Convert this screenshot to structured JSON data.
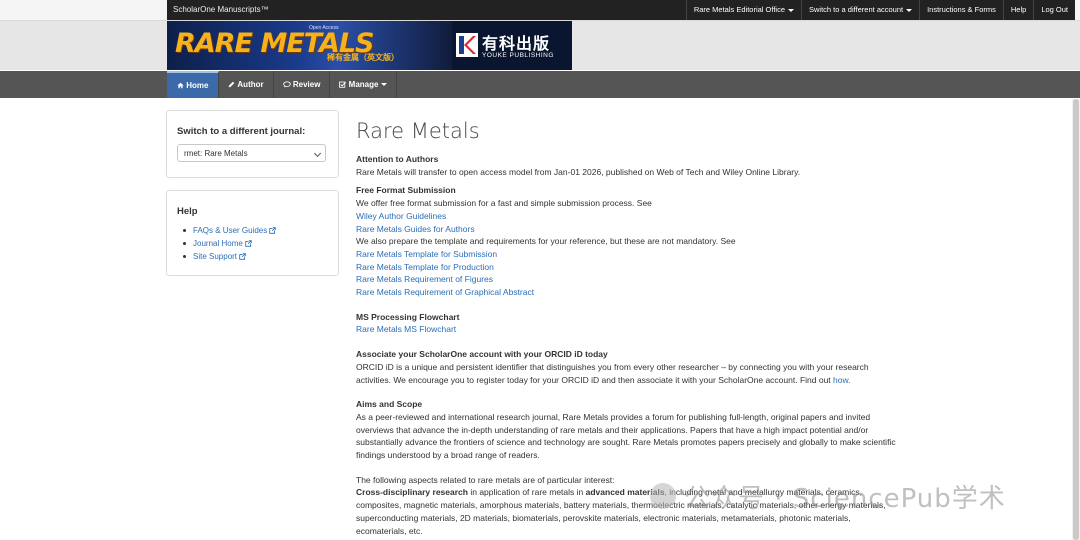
{
  "topbar": {
    "brand": "ScholarOne Manuscripts™",
    "items": [
      {
        "label": "Rare Metals Editorial Office",
        "dropdown": true
      },
      {
        "label": "Switch to a different account",
        "dropdown": true
      },
      {
        "label": "Instructions & Forms",
        "dropdown": false
      },
      {
        "label": "Help",
        "dropdown": false
      },
      {
        "label": "Log Out",
        "dropdown": false
      }
    ]
  },
  "banner": {
    "logo_text": "RARE METALS",
    "open_access": "Open Access",
    "chinese_title": "稀有金属（英文版）",
    "publisher_cn": "有科出版",
    "publisher_en": "YOUKE PUBLISHING"
  },
  "mainnav": {
    "items": [
      {
        "label": "Home",
        "icon": "home-icon",
        "active": true
      },
      {
        "label": "Author",
        "icon": "pencil-icon",
        "active": false
      },
      {
        "label": "Review",
        "icon": "comment-icon",
        "active": false
      },
      {
        "label": "Manage",
        "icon": "checkbox-icon",
        "active": false,
        "dropdown": true
      }
    ]
  },
  "sidebar": {
    "switch_title": "Switch to a different journal:",
    "journal_select": "rmet: Rare Metals",
    "help_title": "Help",
    "help_links": [
      "FAQs & User Guides",
      "Journal Home",
      "Site Support"
    ]
  },
  "main": {
    "title": "Rare Metals",
    "attention_heading": "Attention to Authors",
    "attention_text": "Rare Metals will transfer to open access model from Jan-01 2026,  published on Web of Tech and Wiley Online Library.",
    "free_heading": "Free Format Submission",
    "free_text": "We offer free format submission for a fast and simple submission process. See",
    "link_wiley": "Wiley Author Guidelines",
    "link_guides": "Rare Metals Guides for Authors",
    "template_text": "We also prepare the template and requirements for your reference, but these are not mandatory. See",
    "link_tpl_sub": "Rare Metals Template for Submission",
    "link_tpl_prod": "Rare Metals Template for Production",
    "link_req_fig": "Rare Metals Requirement of Figures",
    "link_req_ga": "Rare Metals Requirement of Graphical Abstract",
    "ms_heading": "MS Processing Flowchart",
    "link_flow": "Rare Metals MS Flowchart",
    "orcid_heading": "Associate your ScholarOne account with your ORCID iD today",
    "orcid_text": "ORCID iD is a unique and persistent identifier that distinguishes you from every other researcher – by connecting you with your research activities. We encourage you to register today for your ORCID iD and then associate it with your ScholarOne account. Find out",
    "orcid_link": "how.",
    "aims_heading": "Aims and Scope",
    "aims_text": "As a peer-reviewed and international research journal, Rare Metals provides a forum for publishing full-length, original papers and invited overviews that advance the in-depth understanding of rare metals and their applications. Papers that have a high impact potential and/or substantially advance the frontiers of science and technology are sought. Rare Metals promotes papers precisely and globally to make scientific findings understood by a broad range of readers.",
    "aspects_text": "The following aspects related to rare metals are of particular interest:",
    "cross_bold1": "Cross-disciplinary research",
    "cross_mid": " in application of rare metals in ",
    "cross_bold2": "advanced materials",
    "cross_rest": ", including metal and metallurgy materials, ceramics, composites, magnetic materials, amorphous materials, battery materials, thermoelectric materials, catalytic materials, other energy materials, superconducting materials, 2D materials, biomaterials, perovskite materials, electronic materials, metamaterials, photonic materials, ecomaterials, etc."
  },
  "watermark": {
    "text": "公众号 · SciencePub学术"
  },
  "colors": {
    "topbar": "#222222",
    "nav": "#555555",
    "nav_active": "#3c6aa8",
    "link": "#2a6eb8",
    "logo_gold": "#f6b21a"
  }
}
